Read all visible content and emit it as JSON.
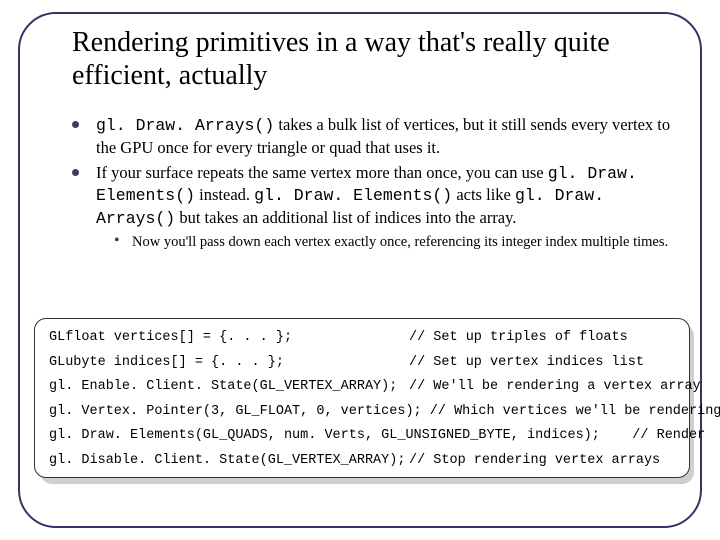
{
  "title": "Rendering primitives in a way that's really quite efficient, actually",
  "bullets": [
    {
      "pre": "",
      "code1": "gl. Draw. Arrays()",
      "mid1": " takes a bulk list of vertices, but it still sends every vertex to the GPU once for every triangle or quad that uses it."
    },
    {
      "pre": "If your surface repeats the same vertex more than once, you can use ",
      "code1": "gl. Draw. Elements()",
      "mid1": " instead. ",
      "code2": "gl. Draw. Elements()",
      "mid2": " acts like ",
      "code3": "gl. Draw. Arrays()",
      "mid3": " but takes an additional list of indices into the array."
    }
  ],
  "subbullet": "Now you'll pass down each vertex exactly once, referencing its integer index multiple times.",
  "code": {
    "l1a": "GLfloat vertices[] = {. . . };",
    "l1b": "// Set up triples of floats",
    "l2a": "GLubyte indices[] = {. . . };",
    "l2b": "// Set up vertex indices list",
    "l3a": "gl. Enable. Client. State(GL_VERTEX_ARRAY);",
    "l3b": "// We'll be rendering a vertex array",
    "l4a": "gl. Vertex. Pointer(3, GL_FLOAT, 0, vertices); ",
    "l4b": "// Which vertices we'll be rendering",
    "l5a": "gl. Draw. Elements(GL_QUADS, num. Verts, GL_UNSIGNED_BYTE, indices);    ",
    "l5b": "// Render",
    "l6a": "gl. Disable. Client. State(GL_VERTEX_ARRAY);",
    "l6b": "// Stop rendering vertex arrays"
  }
}
